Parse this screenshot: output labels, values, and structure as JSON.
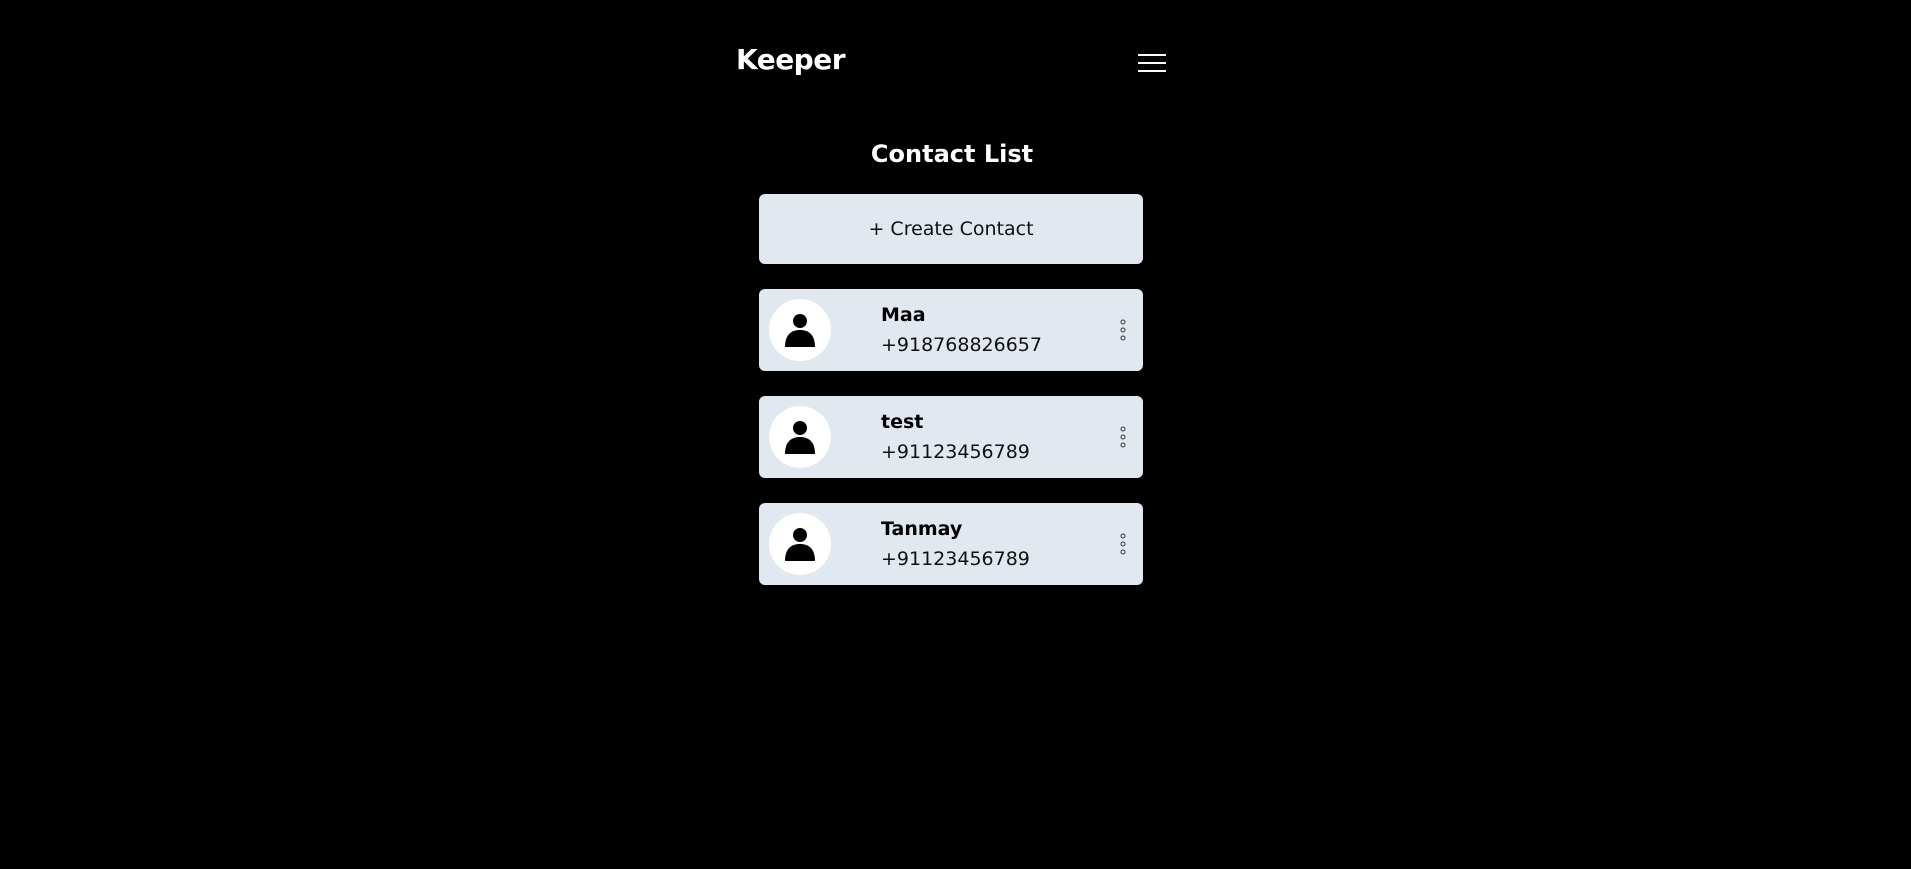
{
  "header": {
    "brand": "Keeper",
    "menu_icon": "hamburger-menu-icon"
  },
  "main": {
    "title": "Contact List",
    "create_label": "+ Create Contact",
    "contacts": [
      {
        "name": "Maa",
        "phone": "+918768826657"
      },
      {
        "name": "test",
        "phone": "+91123456789"
      },
      {
        "name": "Tanmay",
        "phone": "+91123456789"
      }
    ]
  },
  "colors": {
    "background": "#000000",
    "card": "#e2e8f0",
    "text_light": "#ffffff"
  }
}
